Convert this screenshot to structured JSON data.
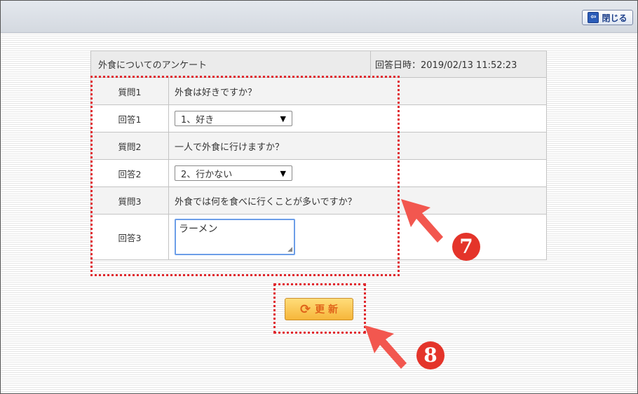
{
  "header": {
    "close_label": "閉じる"
  },
  "survey": {
    "title": "外食についてのアンケート",
    "date_label": "回答日時：2019/02/13 11:52:23",
    "rows": [
      {
        "label": "質問1",
        "text": "外食は好きですか？"
      },
      {
        "label": "回答1",
        "value": "1、好き"
      },
      {
        "label": "質問2",
        "text": "一人で外食に行けますか？"
      },
      {
        "label": "回答2",
        "value": "2、行かない"
      },
      {
        "label": "質問3",
        "text": "外食では何を食べに行くことが多いですか？"
      },
      {
        "label": "回答3",
        "value": "ラーメン"
      }
    ]
  },
  "actions": {
    "update_label": "更 新"
  },
  "callouts": {
    "marker_7": "7",
    "marker_8": "8",
    "color": "#e0282e"
  }
}
